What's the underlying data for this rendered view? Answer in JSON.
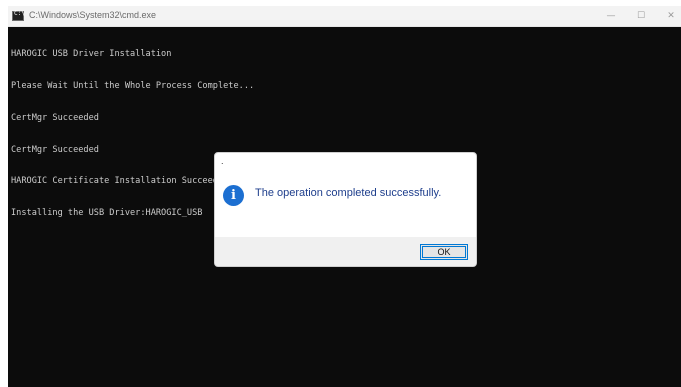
{
  "window": {
    "title": "C:\\Windows\\System32\\cmd.exe",
    "minimize_glyph": "—",
    "maximize_glyph": "☐",
    "close_glyph": "✕"
  },
  "console": {
    "lines": [
      "HAROGIC USB Driver Installation",
      "Please Wait Until the Whole Process Complete...",
      "CertMgr Succeeded",
      "CertMgr Succeeded",
      "HAROGIC Certificate Installation Succeeded",
      "Installing the USB Driver:HAROGIC_USB"
    ]
  },
  "dialog": {
    "title": ".",
    "icon": "info-icon",
    "icon_glyph": "i",
    "message": "The operation completed successfully.",
    "ok_label": "OK"
  },
  "colors": {
    "console_bg": "#0c0c0c",
    "console_text": "#cccccc",
    "info_icon": "#1c6fd1",
    "message_text": "#1e3e8c",
    "focus_border": "#0078d4"
  }
}
